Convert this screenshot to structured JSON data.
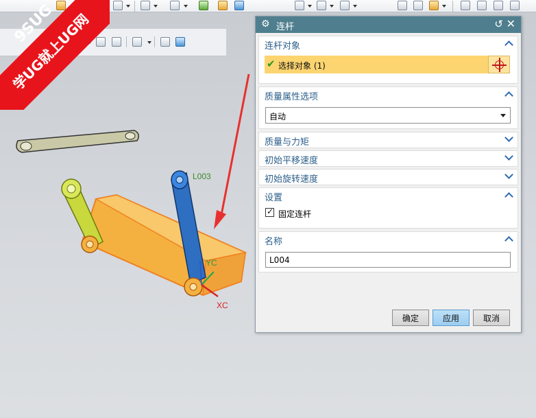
{
  "watermark": {
    "line1": "9SUG",
    "line2": "学UG就上UG网"
  },
  "viewport": {
    "label_link": "L003",
    "label_yc": "YC",
    "label_xc": "XC"
  },
  "dialog": {
    "title": "连杆",
    "sections": {
      "link_object": {
        "header": "连杆对象",
        "select_label": "选择对象 (1)"
      },
      "mass_props": {
        "header": "质量属性选项",
        "selected": "自动"
      },
      "mass_torque": {
        "header": "质量与力矩"
      },
      "initial_translation": {
        "header": "初始平移速度"
      },
      "initial_rotation": {
        "header": "初始旋转速度"
      },
      "settings": {
        "header": "设置",
        "fixed_link_label": "固定连杆",
        "fixed_link_checked": true
      },
      "name": {
        "header": "名称",
        "value": "L004"
      }
    },
    "buttons": {
      "ok": "确定",
      "apply": "应用",
      "cancel": "取消"
    }
  },
  "colors": {
    "title_bar": "#4f7f8e",
    "highlight_row": "#fcd470",
    "section_header": "#2c5f8a",
    "watermark": "#e8141c",
    "annotation_arrow": "#e83030"
  }
}
